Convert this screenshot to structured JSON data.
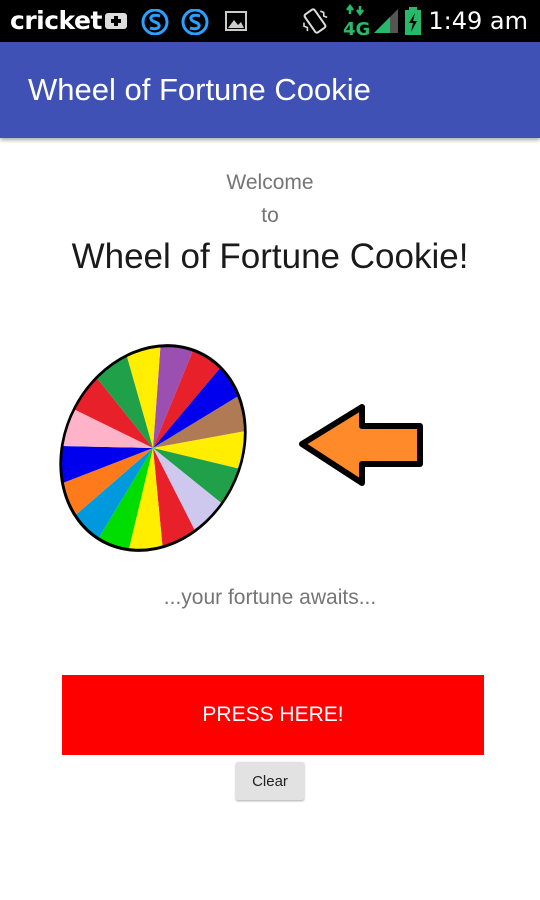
{
  "status_bar": {
    "carrier": "cricket",
    "network": "4G",
    "time": "1:49 am",
    "icons": [
      "plus-badge-icon",
      "sync-s-icon",
      "sync-s-icon",
      "image-icon",
      "vibrate-icon",
      "network-4g-icon",
      "signal-icon",
      "battery-charging-icon"
    ]
  },
  "app_bar": {
    "title": "Wheel of Fortune Cookie"
  },
  "main": {
    "welcome_line1": "Welcome",
    "welcome_line2": "to",
    "headline": "Wheel of Fortune Cookie!",
    "tagline": "...your fortune awaits...",
    "wheel_colors": [
      "#9b4fb0",
      "#e8202a",
      "#0000ee",
      "#b07a55",
      "#ffee00",
      "#21a04a",
      "#cfc8ee",
      "#e8202a",
      "#ffee00",
      "#00dd00",
      "#0099dd",
      "#ff7a1a",
      "#0000ee",
      "#ffb3c8",
      "#e8202a",
      "#21a04a",
      "#ffee00"
    ],
    "arrow_color": "#ff8a2a"
  },
  "buttons": {
    "press_label": "PRESS HERE!",
    "clear_label": "Clear",
    "press_color": "#ff0000"
  }
}
